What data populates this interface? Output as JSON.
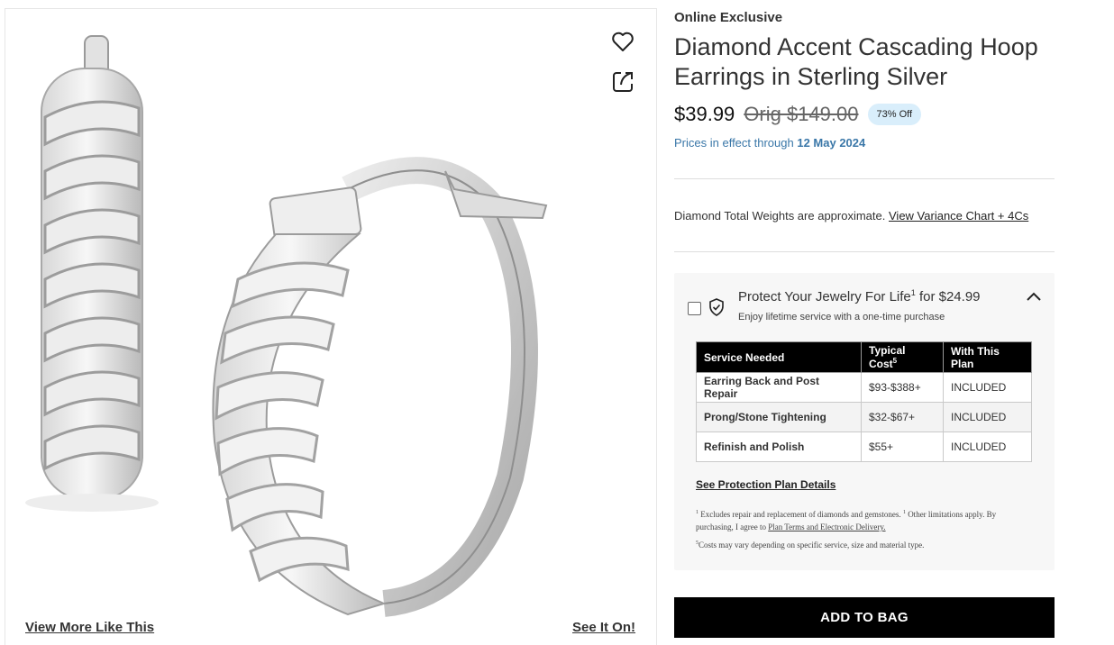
{
  "gallery": {
    "wishlist_icon": "heart-icon",
    "share_icon": "share-icon",
    "view_more_label": "View More Like This",
    "see_it_label": "See It On!"
  },
  "product": {
    "badge_label": "Online Exclusive",
    "title": "Diamond Accent Cascading Hoop Earrings in Sterling Silver",
    "price": "$39.99",
    "orig_price": "Orig  $149.00",
    "discount_badge": "73% Off",
    "price_effect_prefix": "Prices in effect through",
    "price_effect_date": "12 May 2024",
    "weights_note": "Diamond Total Weights are approximate.",
    "weights_link": "View Variance Chart + 4Cs"
  },
  "protection": {
    "title_prefix": "Protect Your Jewelry For Life",
    "title_sup": "1",
    "title_suffix": " for $24.99",
    "subtitle": "Enjoy lifetime service with a one-time purchase",
    "headers": {
      "service": "Service Needed",
      "cost": "Typical Cost",
      "cost_sup": "5",
      "plan": "With This Plan"
    },
    "rows": [
      {
        "service": "Earring Back and Post Repair",
        "cost": "$93-$388+",
        "plan": "INCLUDED"
      },
      {
        "service": "Prong/Stone Tightening",
        "cost": "$32-$67+",
        "plan": "INCLUDED"
      },
      {
        "service": "Refinish and Polish",
        "cost": "$55+",
        "plan": "INCLUDED"
      }
    ],
    "details_link": "See Protection Plan Details",
    "fine1_sup_a": "1",
    "fine1_a": " Excludes repair and replacement of diamonds and gemstones. ",
    "fine1_sup_b": "1",
    "fine1_b": " Other limitations apply. By purchasing, I agree to ",
    "fine1_link": "Plan Terms and Electronic Delivery.",
    "fine2_sup": "5",
    "fine2": "Costs may vary depending on specific service, size and material type."
  },
  "cta": {
    "add_to_bag": "ADD TO BAG"
  }
}
